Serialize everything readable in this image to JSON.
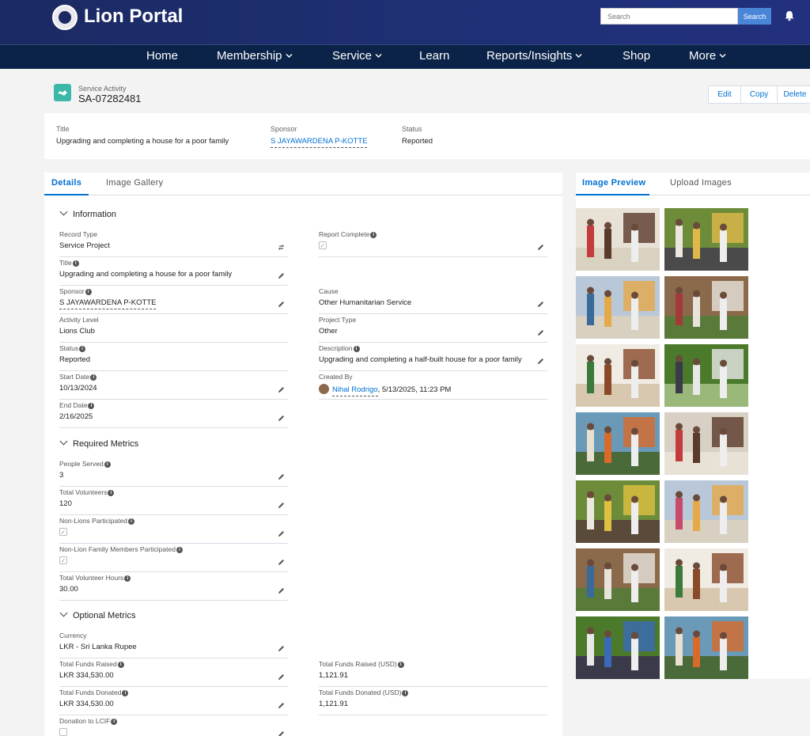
{
  "header": {
    "brand": "Lion Portal",
    "search_placeholder": "Search",
    "search_button": "Search"
  },
  "nav": [
    {
      "label": "Home",
      "has_menu": false
    },
    {
      "label": "Membership",
      "has_menu": true
    },
    {
      "label": "Service",
      "has_menu": true
    },
    {
      "label": "Learn",
      "has_menu": false
    },
    {
      "label": "Reports/Insights",
      "has_menu": true
    },
    {
      "label": "Shop",
      "has_menu": false
    },
    {
      "label": "More",
      "has_menu": true
    }
  ],
  "record": {
    "type_label": "Service Activity",
    "id": "SA-07282481",
    "actions": [
      "Edit",
      "Copy",
      "Delete"
    ]
  },
  "highlights": {
    "title_label": "Title",
    "title": "Upgrading and completing a house for a poor family",
    "sponsor_label": "Sponsor",
    "sponsor": "S JAYAWARDENA P-KOTTE",
    "status_label": "Status",
    "status": "Reported"
  },
  "tabs_left": [
    "Details",
    "Image Gallery"
  ],
  "tabs_right": [
    "Image Preview",
    "Upload Images"
  ],
  "sections": {
    "information": {
      "title": "Information",
      "left": [
        {
          "label": "Record Type",
          "value": "Service Project",
          "info": false,
          "edit": "change"
        },
        {
          "label": "Title",
          "value": "Upgrading and completing a house for a poor family",
          "info": true,
          "edit": "pencil"
        },
        {
          "label": "Sponsor",
          "value": "S JAYAWARDENA P-KOTTE",
          "info": true,
          "edit": "pencil",
          "link": true
        },
        {
          "label": "Activity Level",
          "value": "Lions Club",
          "info": false,
          "edit": "none"
        },
        {
          "label": "Status",
          "value": "Reported",
          "info": true,
          "edit": "none"
        },
        {
          "label": "Start Date",
          "value": "10/13/2024",
          "info": true,
          "edit": "pencil"
        },
        {
          "label": "End Date",
          "value": "2/16/2025",
          "info": true,
          "edit": "pencil"
        }
      ],
      "right": [
        {
          "label": "Report Complete",
          "value": "",
          "info": true,
          "edit": "pencil",
          "checkbox": true,
          "checked": true,
          "row": 0
        },
        {
          "label": "Cause",
          "value": "Other Humanitarian Service",
          "info": false,
          "edit": "pencil",
          "row": 2
        },
        {
          "label": "Project Type",
          "value": "Other",
          "info": false,
          "edit": "pencil",
          "row": 3
        },
        {
          "label": "Description",
          "value": "Upgrading and completing a half-built house for a poor family",
          "info": true,
          "edit": "pencil",
          "row": 4
        },
        {
          "label": "Created By",
          "value": "",
          "info": false,
          "edit": "none",
          "row": 5,
          "created_by": true
        }
      ],
      "created_by": {
        "name": "Nihal Rodrigo",
        "date": ", 5/13/2025, 11:23 PM"
      }
    },
    "required": {
      "title": "Required Metrics",
      "left": [
        {
          "label": "People Served",
          "value": "3",
          "info": true,
          "edit": "pencil"
        },
        {
          "label": "Total Volunteers",
          "value": "120",
          "info": true,
          "edit": "pencil"
        },
        {
          "label": "Non-Lions Participated",
          "value": "",
          "info": true,
          "edit": "pencil",
          "checkbox": true,
          "checked": true
        },
        {
          "label": "Non-Lion Family Members Participated",
          "value": "",
          "info": true,
          "edit": "pencil",
          "checkbox": true,
          "checked": true
        },
        {
          "label": "Total Volunteer Hours",
          "value": "30.00",
          "info": true,
          "edit": "pencil"
        }
      ]
    },
    "optional": {
      "title": "Optional Metrics",
      "left": [
        {
          "label": "Currency",
          "value": "LKR - Sri Lanka Rupee",
          "info": false,
          "edit": "pencil"
        },
        {
          "label": "Total Funds Raised",
          "value": "LKR 334,530.00",
          "info": true,
          "edit": "pencil"
        },
        {
          "label": "Total Funds Donated",
          "value": "LKR 334,530.00",
          "info": true,
          "edit": "pencil"
        },
        {
          "label": "Donation to LCIF",
          "value": "",
          "info": true,
          "edit": "pencil",
          "checkbox": true,
          "checked": false
        }
      ],
      "right": [
        {
          "label": "Total Funds Raised (USD)",
          "value": "1,121.91",
          "info": true,
          "edit": "none",
          "row": 1
        },
        {
          "label": "Total Funds Donated (USD)",
          "value": "1,121.91",
          "info": true,
          "edit": "none",
          "row": 2
        }
      ]
    }
  },
  "colors": {
    "accent": "#0070d2",
    "header": "#1b2a63",
    "nav": "#0b2348",
    "record_icon": "#3cb8a8"
  },
  "images": [
    {
      "name": "photo-1",
      "palette": [
        "#e8e2d6",
        "#5a3a2a",
        "#c33b3b",
        "#d9d2c0"
      ]
    },
    {
      "name": "photo-2",
      "palette": [
        "#6c8c3a",
        "#e0b84a",
        "#ece8e0",
        "#4a4a4a"
      ]
    },
    {
      "name": "photo-3",
      "palette": [
        "#b8c8d8",
        "#e6a94a",
        "#3a6a9a",
        "#d8d0c0"
      ]
    },
    {
      "name": "photo-4",
      "palette": [
        "#8a6a4a",
        "#e8e4dc",
        "#a33a3a",
        "#5a7a3a"
      ]
    },
    {
      "name": "photo-5",
      "palette": [
        "#f0ece4",
        "#8a4a2a",
        "#3a7a3a",
        "#d8c8b0"
      ]
    },
    {
      "name": "photo-6",
      "palette": [
        "#4a7a2a",
        "#e8e8e8",
        "#3a3a4a",
        "#9ab87a"
      ]
    },
    {
      "name": "photo-7",
      "palette": [
        "#6a9ab8",
        "#d86a2a",
        "#e8e0d0",
        "#4a6a3a"
      ]
    },
    {
      "name": "photo-8",
      "palette": [
        "#d8d0c4",
        "#5a3a2a",
        "#c33b3b",
        "#e8e2d6"
      ]
    },
    {
      "name": "photo-9",
      "palette": [
        "#6c8c3a",
        "#e0c040",
        "#ece8e0",
        "#5a4a3a"
      ]
    },
    {
      "name": "photo-10",
      "palette": [
        "#b8c8d8",
        "#e6a94a",
        "#c84a6a",
        "#d8d0c0"
      ]
    },
    {
      "name": "photo-11",
      "palette": [
        "#8a6a4a",
        "#e8e4dc",
        "#3a6a9a",
        "#5a7a3a"
      ]
    },
    {
      "name": "photo-12",
      "palette": [
        "#f0ece4",
        "#8a4a2a",
        "#3a7a3a",
        "#d8c8b0"
      ]
    },
    {
      "name": "photo-13",
      "palette": [
        "#4a7a2a",
        "#3a6ab8",
        "#e8e8e8",
        "#3a3a4a"
      ]
    },
    {
      "name": "photo-14",
      "palette": [
        "#6a9ab8",
        "#d86a2a",
        "#e8e0d0",
        "#4a6a3a"
      ]
    }
  ]
}
